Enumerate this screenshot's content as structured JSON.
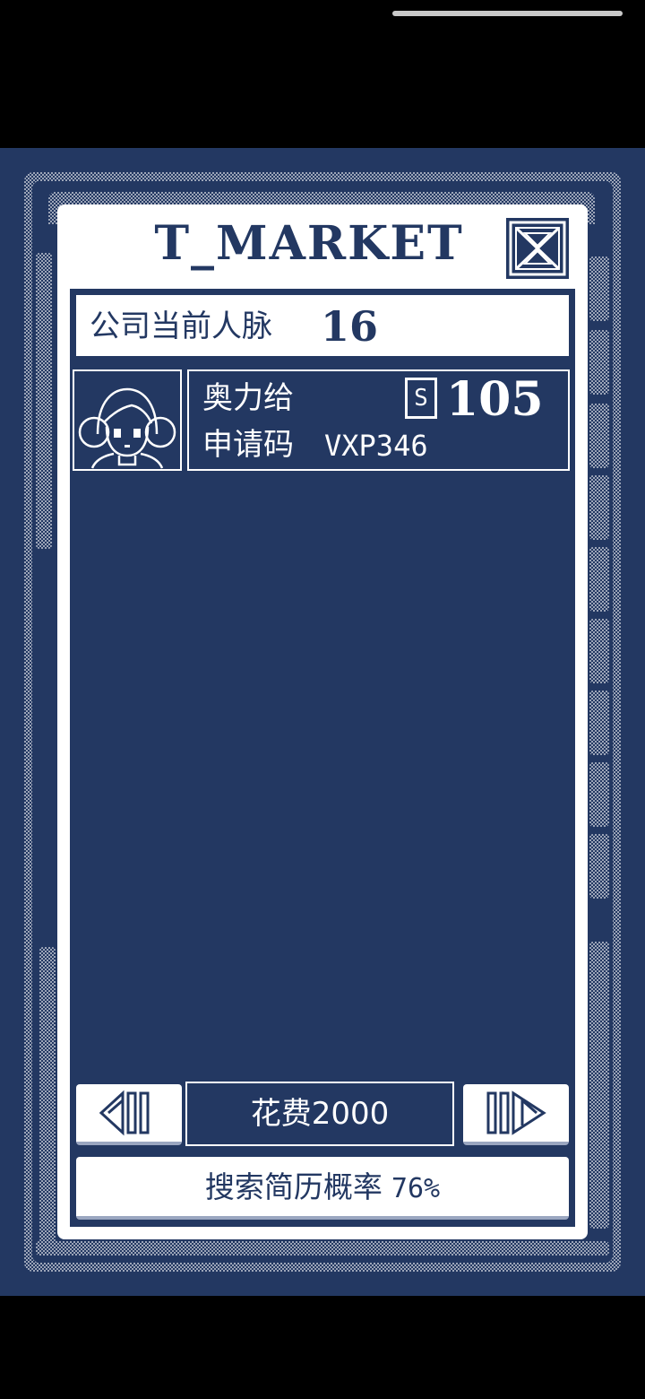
{
  "window": {
    "title": "T_MARKET"
  },
  "header": {
    "label": "公司当前人脉",
    "value": "16"
  },
  "candidate": {
    "name": "奥力给",
    "code_label": "申请码",
    "code": "VXP346",
    "price_icon": "S",
    "price": "105"
  },
  "footer": {
    "cost_text": "花费2000",
    "search_label": "搜索简历概率",
    "search_rate": "76%"
  },
  "icons": {
    "close": "close-icon",
    "prev": "arrow-left-icon",
    "next": "arrow-right-icon",
    "avatar": "girl-avatar-icon"
  },
  "colors": {
    "background": "#233862",
    "foreground": "#ffffff",
    "screen_bars": "#000000"
  }
}
